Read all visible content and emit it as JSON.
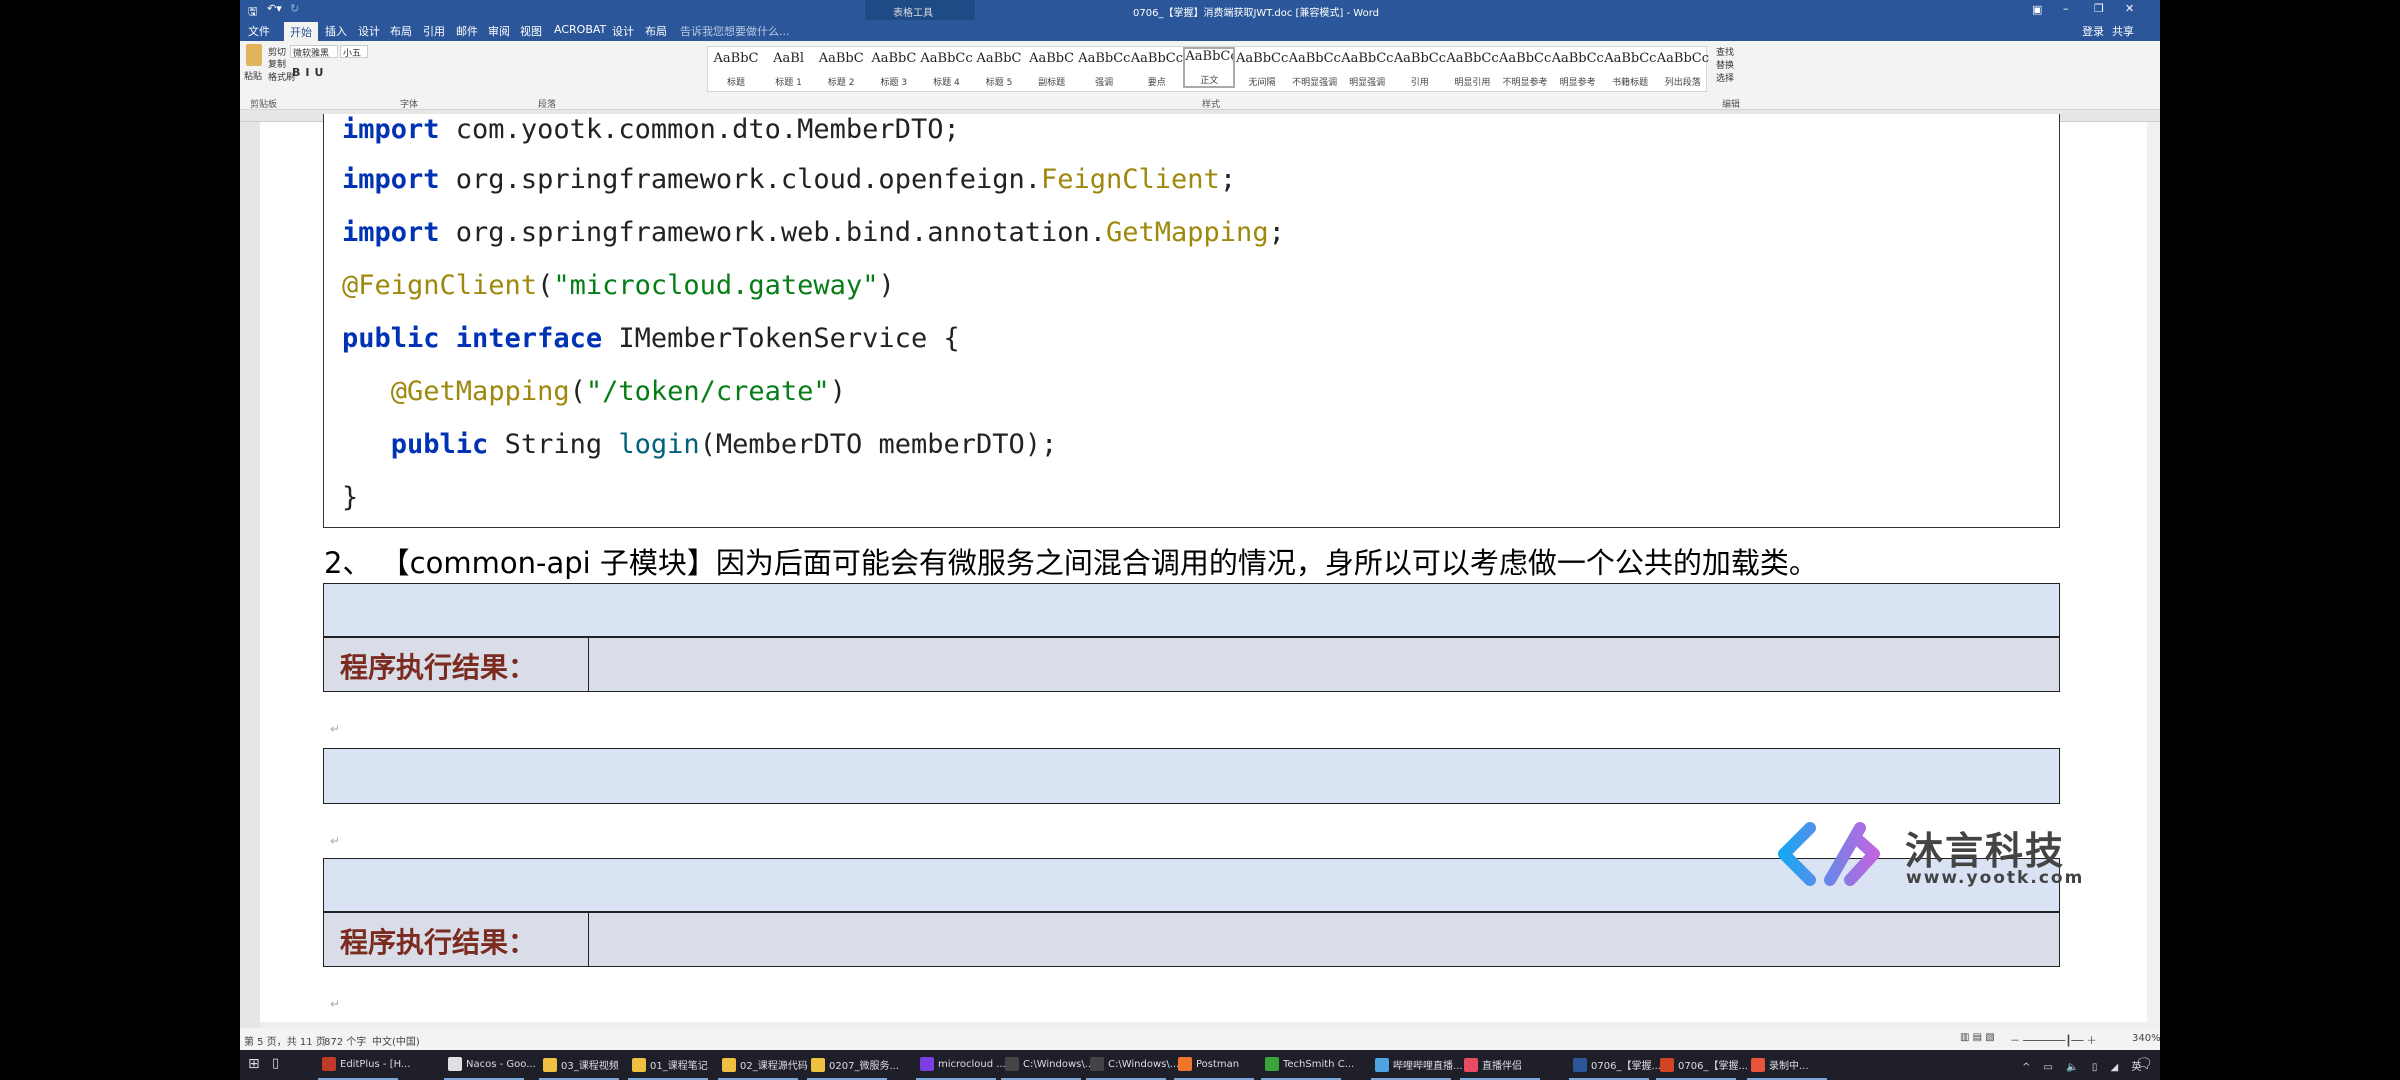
{
  "window": {
    "title": "0706_【掌握】消费端获取JWT.doc [兼容模式] - Word",
    "context_tab": "表格工具",
    "signin": "登录",
    "share": "共享"
  },
  "tabs": [
    "文件",
    "开始",
    "插入",
    "设计",
    "布局",
    "引用",
    "邮件",
    "审阅",
    "视图",
    "ACROBAT",
    "设计",
    "布局"
  ],
  "active_tab": "开始",
  "tell_me": "告诉我您想要做什么...",
  "ribbon": {
    "clipboard": {
      "paste": "粘贴",
      "cut": "剪切",
      "copy": "复制",
      "format_painter": "格式刷",
      "label": "剪贴板"
    },
    "font": {
      "name": "微软雅黑",
      "size": "小五",
      "label": "字体"
    },
    "paragraph": {
      "label": "段落"
    },
    "styles": {
      "label": "样式",
      "items": [
        {
          "preview": "AaBbC",
          "name": "标题"
        },
        {
          "preview": "AaBl",
          "name": "标题 1"
        },
        {
          "preview": "AaBbC",
          "name": "标题 2"
        },
        {
          "preview": "AaBbC",
          "name": "标题 3"
        },
        {
          "preview": "AaBbCc",
          "name": "标题 4"
        },
        {
          "preview": "AaBbC",
          "name": "标题 5"
        },
        {
          "preview": "AaBbC",
          "name": "副标题"
        },
        {
          "preview": "AaBbCcDc",
          "name": "强调"
        },
        {
          "preview": "AaBbCcD",
          "name": "要点"
        },
        {
          "preview": "AaBbCcDc",
          "name": "正文"
        },
        {
          "preview": "AaBbCcDc",
          "name": "无间隔"
        },
        {
          "preview": "AaBbCcDc",
          "name": "不明显强调"
        },
        {
          "preview": "AaBbCcDc",
          "name": "明显强调"
        },
        {
          "preview": "AaBbCcDc",
          "name": "引用"
        },
        {
          "preview": "AaBbCcDc",
          "name": "明显引用"
        },
        {
          "preview": "AaBbCcD",
          "name": "不明显参考"
        },
        {
          "preview": "AaBbCcI",
          "name": "明显参考"
        },
        {
          "preview": "AaBbCcD",
          "name": "书籍标题"
        },
        {
          "preview": "AaBbCcDc",
          "name": "列出段落"
        }
      ]
    },
    "editing": {
      "find": "查找",
      "replace": "替换",
      "select": "选择",
      "label": "编辑"
    }
  },
  "document": {
    "code_lines": [
      [
        {
          "t": "import ",
          "c": "kw"
        },
        {
          "t": "com.yootk.common.dto.MemberDTO;",
          "c": ""
        }
      ],
      [
        {
          "t": "import ",
          "c": "kw"
        },
        {
          "t": "org.springframework.cloud.openfeign.",
          "c": ""
        },
        {
          "t": "FeignClient",
          "c": "an"
        },
        {
          "t": ";",
          "c": ""
        }
      ],
      [
        {
          "t": "import ",
          "c": "kw"
        },
        {
          "t": "org.springframework.web.bind.annotation.",
          "c": ""
        },
        {
          "t": "GetMapping",
          "c": "an"
        },
        {
          "t": ";",
          "c": ""
        }
      ],
      [
        {
          "t": "@FeignClient",
          "c": "an"
        },
        {
          "t": "(",
          "c": ""
        },
        {
          "t": "\"microcloud.gateway\"",
          "c": "st"
        },
        {
          "t": ")",
          "c": ""
        }
      ],
      [
        {
          "t": "public interface ",
          "c": "kw"
        },
        {
          "t": "IMemberTokenService {",
          "c": ""
        }
      ],
      [
        {
          "t": "   ",
          "c": ""
        },
        {
          "t": "@GetMapping",
          "c": "an"
        },
        {
          "t": "(",
          "c": ""
        },
        {
          "t": "\"/token/create\"",
          "c": "st"
        },
        {
          "t": ")",
          "c": ""
        }
      ],
      [
        {
          "t": "   ",
          "c": ""
        },
        {
          "t": "public ",
          "c": "kw"
        },
        {
          "t": "String ",
          "c": ""
        },
        {
          "t": "login",
          "c": "mt"
        },
        {
          "t": "(MemberDTO memberDTO);",
          "c": ""
        }
      ],
      [
        {
          "t": "}",
          "c": ""
        }
      ]
    ],
    "heading": "2、 【common-api 子模块】因为后面可能会有微服务之间混合调用的情况，身所以可以考虑做一个公共的加载类。",
    "result_label": "程序执行结果："
  },
  "status": {
    "page": "第 5 页，共 11 页",
    "words": "872 个字",
    "language": "中文(中国)",
    "zoom": "340%"
  },
  "taskbar": [
    "EditPlus - [H...",
    "Nacos - Goo...",
    "03_课程视频",
    "01_课程笔记",
    "02_课程源代码",
    "0207_微服务...",
    "microcloud ...",
    "C:\\Windows\\...",
    "C:\\Windows\\...",
    "Postman",
    "TechSmith C...",
    "哔哩哔哩直播...",
    "直播伴侣",
    "0706_【掌握...",
    "0706_【掌握...",
    "录制中..."
  ],
  "watermark": {
    "name": "沐言科技",
    "url": "www.yootk.com"
  },
  "colors": {
    "word_blue": "#2b579a",
    "keyword": "#0033b3",
    "annotation": "#9e880d",
    "string": "#067d17",
    "label": "#7b2b1f",
    "table_fill": "#dae3f3"
  }
}
